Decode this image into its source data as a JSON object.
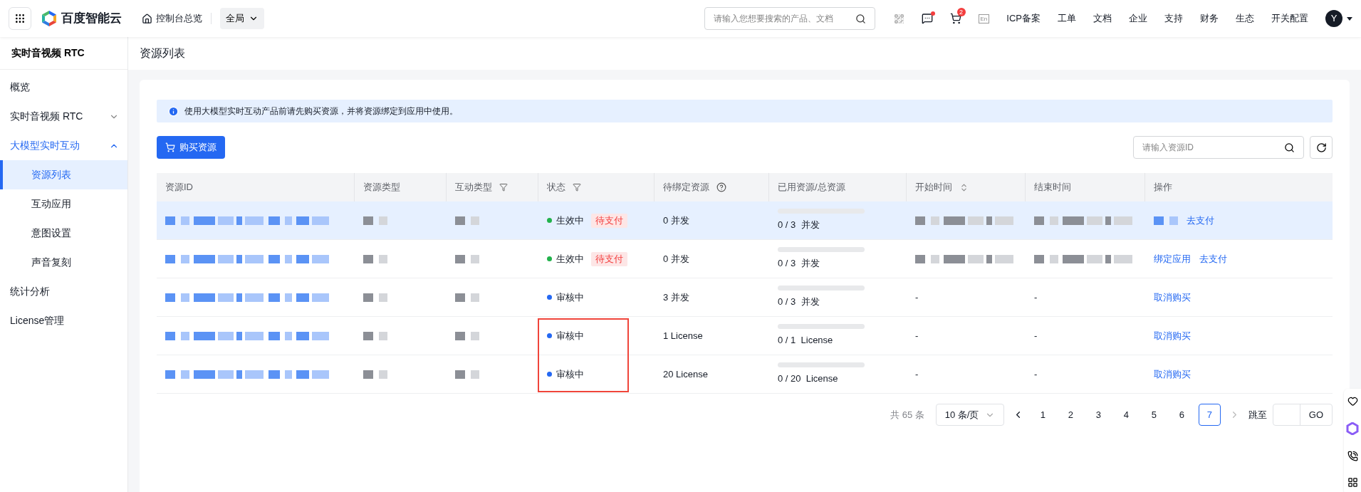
{
  "topbar": {
    "brand": "百度智能云",
    "home": "控制台总览",
    "scope": "全局",
    "search": {
      "placeholder": "请输入您想要搜索的产品、文档"
    },
    "message_dot": true,
    "cart_badge": "2",
    "lang": "En",
    "links": [
      "ICP备案",
      "工单",
      "文档",
      "企业",
      "支持",
      "财务",
      "生态",
      "开关配置"
    ],
    "avatar": "Y"
  },
  "sidebar": {
    "title": "实时音视频 RTC",
    "items": [
      {
        "label": "概览",
        "selected": false
      },
      {
        "label": "实时音视频 RTC",
        "expanded": false,
        "selected": false
      },
      {
        "label": "大模型实时互动",
        "expanded": true,
        "selected": true,
        "children": [
          {
            "label": "资源列表",
            "selected": true
          },
          {
            "label": "互动应用",
            "selected": false
          },
          {
            "label": "意图设置",
            "selected": false
          },
          {
            "label": "声音复刻",
            "selected": false
          }
        ]
      },
      {
        "label": "统计分析",
        "selected": false
      },
      {
        "label": "License管理",
        "selected": false
      }
    ]
  },
  "page_title": "资源列表",
  "notice": "使用大模型实时互动产品前请先购买资源，并将资源绑定到应用中使用。",
  "buy_button": "购买资源",
  "id_search": {
    "placeholder": "请输入资源ID"
  },
  "table": {
    "columns": [
      {
        "label": "资源ID"
      },
      {
        "label": "资源类型"
      },
      {
        "label": "互动类型",
        "kind": "filter"
      },
      {
        "label": "状态",
        "kind": "filter"
      },
      {
        "label": "待绑定资源",
        "kind": "help"
      },
      {
        "label": "已用资源/总资源"
      },
      {
        "label": "开始时间",
        "kind": "sort"
      },
      {
        "label": "结束时间"
      },
      {
        "label": "操作"
      }
    ],
    "rows": [
      {
        "selected": true,
        "outlined": false,
        "status": {
          "label": "生效中",
          "color": "#22b24c"
        },
        "tag": "待支付",
        "pending": "0 并发",
        "used": {
          "level": 0,
          "text": "0 / 3  并发"
        },
        "actions": [
          {
            "kind": "redacted"
          },
          {
            "kind": "link",
            "label": "去支付"
          }
        ]
      },
      {
        "selected": false,
        "outlined": false,
        "status": {
          "label": "生效中",
          "color": "#22b24c"
        },
        "tag": "待支付",
        "pending": "0 并发",
        "used": {
          "level": 0,
          "text": "0 / 3  并发"
        },
        "actions": [
          {
            "kind": "link",
            "label": "绑定应用"
          },
          {
            "kind": "link",
            "label": "去支付"
          }
        ]
      },
      {
        "selected": false,
        "outlined": false,
        "status": {
          "label": "审核中",
          "color": "#2468f2"
        },
        "pending": "3 并发",
        "used": {
          "level": 0,
          "text": "0 / 3  并发"
        },
        "start": "-",
        "end": "-",
        "actions": [
          {
            "kind": "link",
            "label": "取消购买"
          }
        ]
      },
      {
        "selected": false,
        "outlined": true,
        "status": {
          "label": "审核中",
          "color": "#2468f2"
        },
        "pending": "1 License",
        "used": {
          "level": 0,
          "text": "0 / 1  License"
        },
        "start": "-",
        "end": "-",
        "actions": [
          {
            "kind": "link",
            "label": "取消购买"
          }
        ]
      },
      {
        "selected": false,
        "outlined": true,
        "status": {
          "label": "审核中",
          "color": "#2468f2"
        },
        "pending": "20 License",
        "used": {
          "level": 0,
          "text": "0 / 20  License"
        },
        "start": "-",
        "end": "-",
        "actions": [
          {
            "kind": "link",
            "label": "取消购买"
          }
        ]
      }
    ]
  },
  "pagination": {
    "total": "共 65 条",
    "page_size": "10 条/页",
    "pages": [
      {
        "label": "1",
        "selected": false
      },
      {
        "label": "2",
        "selected": false
      },
      {
        "label": "3",
        "selected": false
      },
      {
        "label": "4",
        "selected": false
      },
      {
        "label": "5",
        "selected": false
      },
      {
        "label": "6",
        "selected": false
      },
      {
        "label": "7",
        "selected": true
      }
    ],
    "jump": "跳至",
    "go": "GO"
  }
}
